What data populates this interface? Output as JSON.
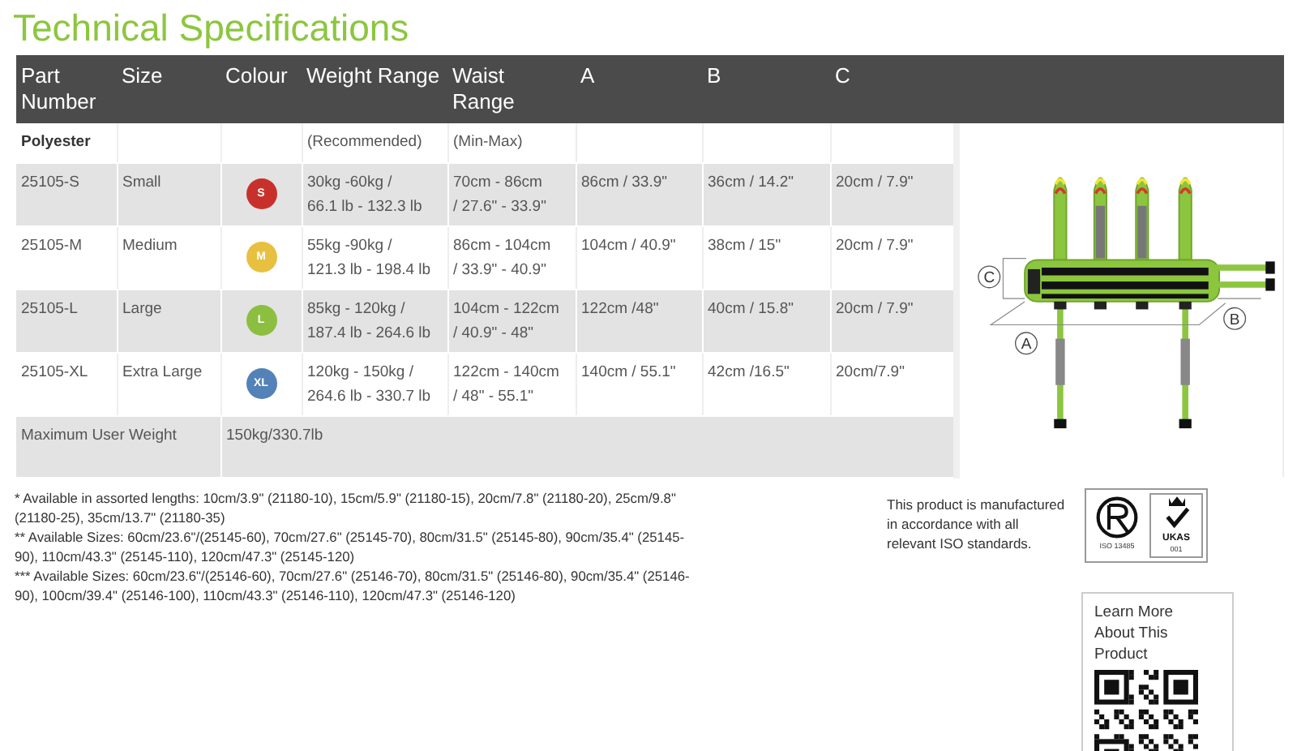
{
  "title": "Technical Specifications",
  "table": {
    "columns": [
      [
        "Part",
        "Number"
      ],
      [
        "Size"
      ],
      [
        "Colour"
      ],
      [
        "Weight Range"
      ],
      [
        "Waist Range"
      ],
      [
        "A"
      ],
      [
        "B"
      ],
      [
        "C"
      ]
    ],
    "rows": [
      {
        "kind": "group",
        "label": "Polyester",
        "weight_note": "(Recommended)",
        "waist_note": "(Min-Max)"
      },
      {
        "kind": "size",
        "part_number": "25105-S",
        "size": "Small",
        "badge": {
          "letter": "S",
          "color": "#c8312b"
        },
        "weight": [
          "30kg -60kg /",
          "66.1 lb - 132.3 lb"
        ],
        "waist": [
          "70cm - 86cm",
          "/ 27.6\" - 33.9\""
        ],
        "a": "86cm / 33.9\"",
        "b": "36cm / 14.2\"",
        "c": "20cm / 7.9\""
      },
      {
        "kind": "size",
        "part_number": "25105-M",
        "size": "Medium",
        "badge": {
          "letter": "M",
          "color": "#e8c040"
        },
        "weight": [
          "55kg -90kg /",
          "121.3 lb - 198.4 lb"
        ],
        "waist": [
          "86cm - 104cm",
          "/ 33.9\" - 40.9\""
        ],
        "a": "104cm / 40.9\"",
        "b": "38cm / 15\"",
        "c": "20cm / 7.9\""
      },
      {
        "kind": "size",
        "part_number": "25105-L",
        "size": "Large",
        "badge": {
          "letter": "L",
          "color": "#8cbf3f"
        },
        "weight": [
          "85kg - 120kg /",
          "187.4 lb - 264.6 lb"
        ],
        "waist": [
          "104cm - 122cm",
          "/ 40.9\" - 48\""
        ],
        "a": "122cm /48\"",
        "b": "40cm / 15.8\"",
        "c": "20cm / 7.9\""
      },
      {
        "kind": "size",
        "part_number": "25105-XL",
        "size": "Extra Large",
        "badge": {
          "letter": "XL",
          "color": "#5282b8"
        },
        "weight": [
          "120kg - 150kg /",
          "264.6 lb - 330.7 lb"
        ],
        "waist": [
          "122cm - 140cm",
          "/ 48\" - 55.1\""
        ],
        "a": "140cm / 55.1\"",
        "b": "42cm /16.5\"",
        "c": "20cm/7.9\""
      },
      {
        "kind": "max",
        "label": "Maximum User Weight",
        "value": "150kg/330.7lb"
      }
    ]
  },
  "diagram": {
    "labels": [
      "C",
      "A",
      "B"
    ]
  },
  "footnotes": [
    "* Available in assorted lengths: 10cm/3.9\" (21180-10), 15cm/5.9\" (21180-15), 20cm/7.8\" (21180-20), 25cm/9.8\" (21180-25), 35cm/13.7\" (21180-35)",
    "** Available Sizes: 60cm/23.6\"/(25145-60), 70cm/27.6\" (25145-70), 80cm/31.5\" (25145-80), 90cm/35.4\" (25145-90), 110cm/43.3\" (25145-110), 120cm/47.3\" (25145-120)",
    "*** Available Sizes: 60cm/23.6\"/(25146-60), 70cm/27.6\" (25146-70), 80cm/31.5\" (25146-80), 90cm/35.4\" (25146-90), 100cm/39.4\" (25146-100), 110cm/43.3\" (25146-110), 120cm/47.3\" (25146-120)"
  ],
  "certification": {
    "text": "This product is manufactured in accordance with all relevant ISO standards.",
    "standard": "ISO 13485",
    "mark": "UKAS",
    "number": "001"
  },
  "qr": {
    "title": [
      "Learn More",
      "About This Product"
    ]
  }
}
